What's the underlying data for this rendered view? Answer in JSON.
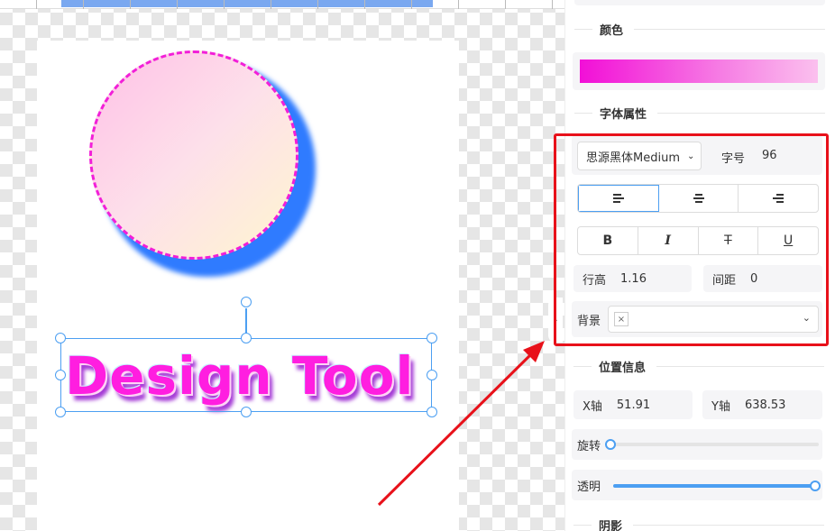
{
  "panel": {
    "color_section": "颜色",
    "font_section": "字体属性",
    "font_family": "思源黑体Medium",
    "font_size_label": "字号",
    "font_size_value": "96",
    "align_buttons": [
      "align-left-icon",
      "align-center-icon",
      "align-right-icon"
    ],
    "style_buttons": {
      "bold": "B",
      "italic": "I",
      "strike": "T",
      "underline": "U"
    },
    "line_height_label": "行高",
    "line_height_value": "1.16",
    "spacing_label": "间距",
    "spacing_value": "0",
    "background_label": "背景",
    "position_section": "位置信息",
    "x_label": "X轴",
    "x_value": "51.91",
    "y_label": "Y轴",
    "y_value": "638.53",
    "rotation_label": "旋转",
    "rotation_value": 0,
    "opacity_label": "透明",
    "opacity_value": 1,
    "shadow_section": "阴影"
  },
  "canvas": {
    "text": "Design Tool"
  },
  "colors": {
    "accent": "#4c9ff2",
    "highlight": "#e8111a",
    "text_fill": "#ff1ee0"
  }
}
